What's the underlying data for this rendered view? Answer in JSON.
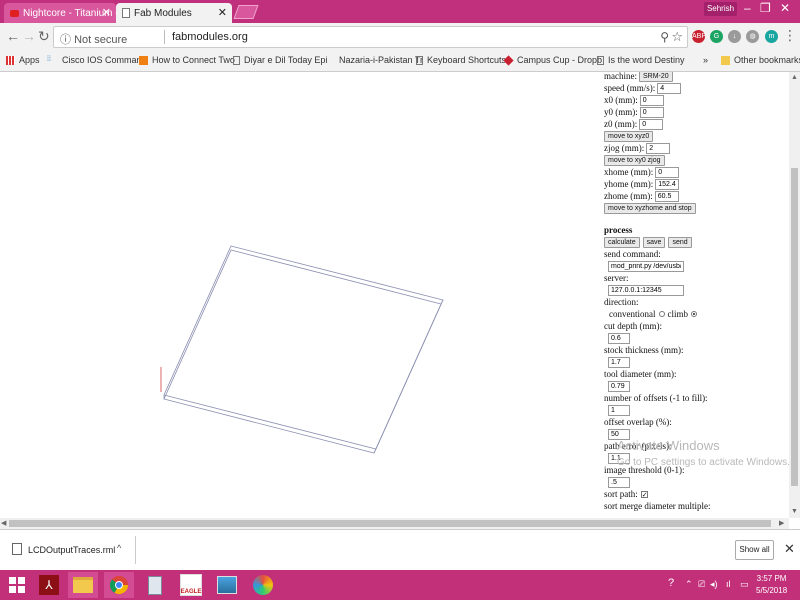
{
  "tabs": [
    {
      "label": "Nightcore - Titanium (Lyri"
    },
    {
      "label": "Fab Modules"
    }
  ],
  "user": {
    "name": "Sehrish"
  },
  "window_controls": {
    "minimize": "–",
    "restore": "❐",
    "close": "✕"
  },
  "address": {
    "security": "Not secure",
    "url": "fabmodules.org"
  },
  "extensions": [
    {
      "name": "ABP",
      "color": "#c8202e"
    },
    {
      "name": "G",
      "color": "#1da462"
    },
    {
      "name": "↓",
      "color": "#9a9a9a"
    },
    {
      "name": "◍",
      "color": "#9a9a9a"
    },
    {
      "name": "m",
      "color": "#19a5a0"
    }
  ],
  "bookmarks": [
    {
      "label": "Apps",
      "icon": "apps-grid-icon"
    },
    {
      "label": "Cisco IOS Command",
      "icon": "cisco-icon"
    },
    {
      "label": "How to Connect Two",
      "icon": "htt-icon"
    },
    {
      "label": "Diyar e Dil Today Epi",
      "icon": "page-icon"
    },
    {
      "label": "Nazaria-i-Pakistan Tr",
      "icon": "none"
    },
    {
      "label": "Keyboard Shortcuts",
      "icon": "page-icon"
    },
    {
      "label": "Campus Cup - Dropb",
      "icon": "dropbox-icon"
    },
    {
      "label": "Is the word Destiny",
      "icon": "page-icon"
    },
    {
      "label": "»",
      "icon": "none"
    },
    {
      "label": "Other bookmarks",
      "icon": "folder-icon"
    }
  ],
  "panel": {
    "machine_label": "machine:",
    "machine_value": "SRM-20",
    "speed_label": "speed (mm/s):",
    "speed": "4",
    "x0_label": "x0 (mm):",
    "x0": "0",
    "y0_label": "y0 (mm):",
    "y0": "0",
    "z0_label": "z0 (mm):",
    "z0": "0",
    "move_xyz0": "move to xyz0",
    "zjog_label": "zjog (mm):",
    "zjog": "2",
    "move_xy0_zjog": "move to xy0 zjog",
    "xhome_label": "xhome (mm):",
    "xhome": "0",
    "yhome_label": "yhome (mm):",
    "yhome": "152.4",
    "zhome_label": "zhome (mm):",
    "zhome": "60.5",
    "move_home_stop": "move to xyzhome and stop",
    "process_title": "process",
    "calculate": "calculate",
    "save": "save",
    "send": "send",
    "send_command_label": "send command:",
    "send_command": "mod_print.py /dev/usb/lp1 ;",
    "server_label": "server:",
    "server": "127.0.0.1:12345",
    "direction_label": "direction:",
    "conventional": "conventional",
    "climb": "climb",
    "cut_depth_label": "cut depth (mm):",
    "cut_depth": "0.6",
    "stock_label": "stock thickness (mm):",
    "stock": "1.7",
    "tool_label": "tool diameter (mm):",
    "tool": "0.79",
    "offsets_label": "number of offsets (-1 to fill):",
    "offsets": "1",
    "overlap_label": "offset overlap (%):",
    "overlap": "50",
    "path_error_label": "path error (pixels):",
    "path_error": "1.1",
    "threshold_label": "image threshold (0-1):",
    "threshold": ".5",
    "sort_path_label": "sort path:",
    "sort_merge_label": "sort merge diameter multiple:"
  },
  "watermark": {
    "title": "Activate Windows",
    "subtitle": "Go to PC settings to activate Windows."
  },
  "download": {
    "filename": "LCDOutputTraces.rml",
    "caret": "^",
    "show_all": "Show all",
    "close": "✕"
  },
  "taskbar": {
    "items": [
      "windows-start",
      "acrobat",
      "file-explorer",
      "chrome",
      "calculator",
      "eagle",
      "photos",
      "paint"
    ],
    "eagle_label": "EAGLE"
  },
  "clock": {
    "time": "3:57 PM",
    "date": "5/5/2018"
  }
}
